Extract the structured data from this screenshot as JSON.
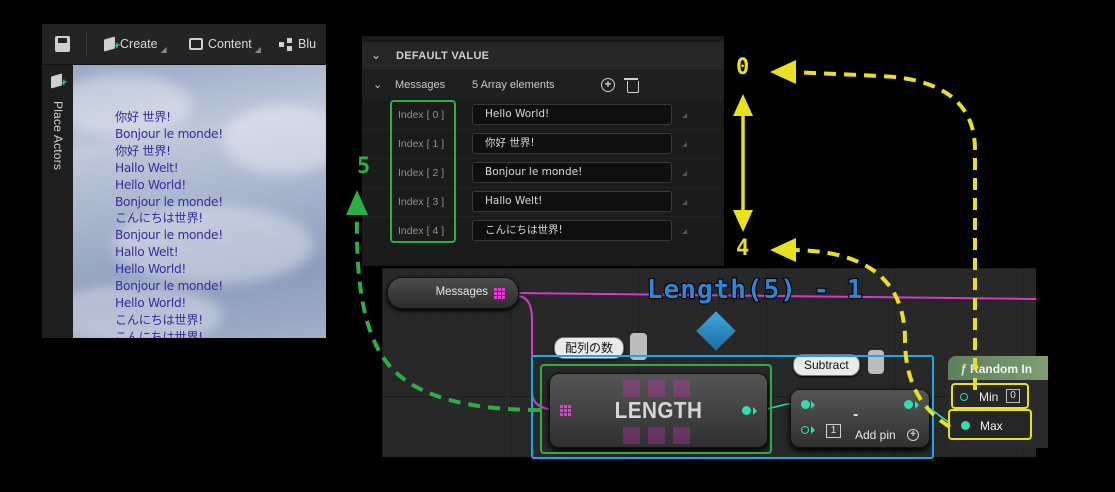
{
  "toolbar": {
    "create_label": "Create",
    "content_label": "Content",
    "blueprint_label": "Blu"
  },
  "sidebar": {
    "place_actors_label": "Place Actors"
  },
  "viewport_lines": [
    "你好 世界!",
    "Bonjour le monde!",
    "你好 世界!",
    "Hallo Welt!",
    "Hello World!",
    "Bonjour le monde!",
    "こんにちは世界!",
    "Bonjour le monde!",
    "Hallo Welt!",
    "Hello World!",
    "Bonjour le monde!",
    "Hello World!",
    "こんにちは世界!",
    "こんにちは世界!"
  ],
  "default_value": {
    "section_title": "DEFAULT VALUE",
    "array_name": "Messages",
    "array_count": "5 Array elements",
    "elements": [
      {
        "index": "Index [ 0 ]",
        "value": "Hello World!"
      },
      {
        "index": "Index [ 1 ]",
        "value": "你好 世界!"
      },
      {
        "index": "Index [ 2 ]",
        "value": "Bonjour le monde!"
      },
      {
        "index": "Index [ 3 ]",
        "value": "Hallo Welt!"
      },
      {
        "index": "Index [ 4 ]",
        "value": "こんにちは世界!"
      }
    ]
  },
  "graph": {
    "messages_node_label": "Messages",
    "length_node_title": "LENGTH",
    "length_comment": "配列の数",
    "subtract_comment": "Subtract",
    "subtract_symbol": "-",
    "subtract_input_value": "1",
    "add_pin_label": "Add pin",
    "random_node_title": "Random In",
    "min_label": "Min",
    "min_value": "0",
    "max_label": "Max"
  },
  "annotations": {
    "length_formula": "Length(5) - 1",
    "zero": "0",
    "four": "4",
    "five": "5"
  },
  "colors": {
    "annotation_yellow": "#e8e020",
    "annotation_green": "#2cae44",
    "annotation_blue": "#1ea7e6",
    "array_pin_magenta": "#e43bd3",
    "int_pin_teal": "#2de0b2"
  }
}
